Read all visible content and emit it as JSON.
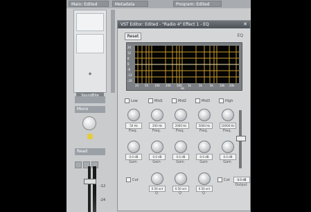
{
  "host": {
    "tabs": [
      "Main: Edited",
      "Metadata",
      "Program: Edited"
    ],
    "strip": {
      "logo_text": "SoundBite",
      "mode_label": "Mono"
    },
    "read_label": "Read",
    "scale_labels": [
      "-12",
      "-24"
    ]
  },
  "plugin": {
    "title": "VST Editor: Edited - \"Radio 4\" Effect 1 - EQ",
    "reset_label": "Reset",
    "eq_label": "EQ",
    "graph": {
      "y_ticks": [
        "20",
        "12",
        "6",
        "0",
        "-6",
        "-12",
        "-20"
      ],
      "x_ticks": [
        "20",
        "50",
        "100",
        "200",
        "500",
        "1k",
        "2k",
        "5k",
        "10k",
        "20k"
      ],
      "x_unit": "Hz"
    },
    "bands": [
      {
        "name": "Low",
        "freq": "50 Hz",
        "gain": "0.0 dB",
        "q": null
      },
      {
        "name": "Mid1",
        "freq": "200 Hz",
        "gain": "0.0 dB",
        "q": "0.50 oct"
      },
      {
        "name": "Mid2",
        "freq": "2000 Hz",
        "gain": "0.0 dB",
        "q": "0.50 oct"
      },
      {
        "name": "Mid3",
        "freq": "5000 Hz",
        "gain": "0.0 dB",
        "q": "0.50 oct"
      },
      {
        "name": "High",
        "freq": "10000 Hz",
        "gain": "0.0 dB",
        "q": null
      }
    ],
    "labels": {
      "freq": "Freq.",
      "gain": "Gain",
      "q": "Q",
      "cut": "Cut"
    },
    "output": {
      "value": "0.0 dB",
      "label": "Output"
    }
  }
}
